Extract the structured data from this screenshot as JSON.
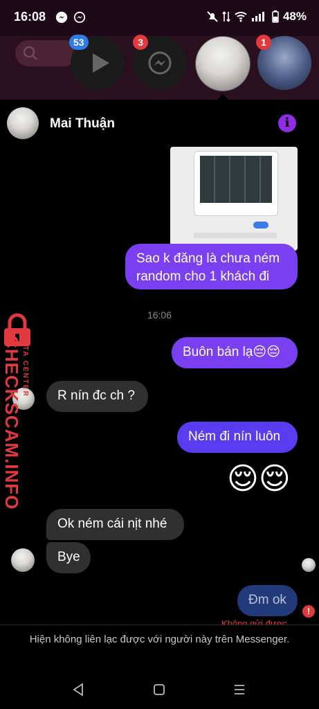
{
  "status_bar": {
    "time": "16:08",
    "battery": "48%"
  },
  "header": {
    "badges": {
      "watch": "53",
      "messenger": "3",
      "story": "1"
    }
  },
  "chat": {
    "contact_name": "Mai Thuận",
    "messages": [
      {
        "from": "me",
        "text": "Sao k đăng là chưa ném random cho 1 khách đi"
      },
      {
        "type": "timestamp",
        "text": "16:06"
      },
      {
        "from": "me",
        "text": "Buôn bán lạ😔😔"
      },
      {
        "from": "them",
        "text": "R nín đc ch ?"
      },
      {
        "from": "me",
        "text": "Ném đi nín luôn"
      },
      {
        "from": "me",
        "text": "😌😌"
      },
      {
        "from": "them",
        "text": "Ok ném cái nịt nhé"
      },
      {
        "from": "them",
        "text": "Bye"
      },
      {
        "from": "me",
        "text": "Đm ok",
        "status": "Không gửi được"
      }
    ]
  },
  "footer": {
    "notice": "Hiện không liên lạc được với người này trên Messenger."
  },
  "watermark": {
    "brand": "CHECKSCAM.INFO",
    "sub": "DATA CENTER"
  },
  "colors": {
    "accent": "#7b3ff2",
    "danger": "#e0393e",
    "info": "#8e2de2"
  }
}
